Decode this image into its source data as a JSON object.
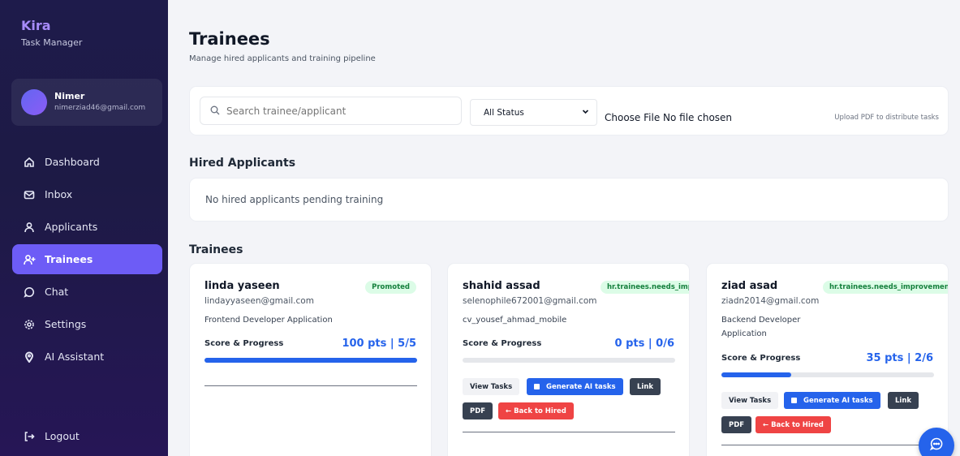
{
  "brand": {
    "name": "Kira",
    "subtitle": "Task Manager"
  },
  "user": {
    "name": "Nimer",
    "email": "nimerziad46@gmail.com"
  },
  "nav": {
    "items": [
      {
        "label": "Dashboard",
        "icon": "home-icon"
      },
      {
        "label": "Inbox",
        "icon": "mail-icon"
      },
      {
        "label": "Applicants",
        "icon": "user-icon"
      },
      {
        "label": "Trainees",
        "icon": "user-plus-icon",
        "active": true
      },
      {
        "label": "Chat",
        "icon": "chat-icon"
      },
      {
        "label": "Settings",
        "icon": "gear-icon"
      },
      {
        "label": "AI Assistant",
        "icon": "pin-icon"
      }
    ],
    "logout": "Logout"
  },
  "header": {
    "title": "Trainees",
    "subtitle": "Manage hired applicants and training pipeline"
  },
  "filters": {
    "search_placeholder": "Search trainee/applicant",
    "status_value": "All Status",
    "file_label": "Choose File No file chosen",
    "upload_hint": "Upload PDF to distribute tasks"
  },
  "hired": {
    "title": "Hired Applicants",
    "empty_text": "No hired applicants pending training"
  },
  "trainees": {
    "title": "Trainees",
    "score_label": "Score & Progress",
    "buttons": {
      "view": "View Tasks",
      "generate": "Generate AI tasks",
      "link": "Link",
      "pdf": "PDF",
      "back": "← Back to Hired"
    },
    "cards": [
      {
        "name": "linda yaseen",
        "badge": "Promoted",
        "email": "lindayyaseen@gmail.com",
        "application": "Frontend Developer Application",
        "score": "100 pts | 5/5",
        "progress": 1.0
      },
      {
        "name": "shahid assad",
        "badge": "hr.trainees.needs_improvement",
        "email": "selenophile672001@gmail.com",
        "application": "cv_yousef_ahmad_mobile",
        "score": "0 pts | 0/6",
        "progress": 0.0
      },
      {
        "name": "ziad asad",
        "badge": "hr.trainees.needs_improvement",
        "email": "ziadn2014@gmail.com",
        "application": "Backend Developer Application",
        "score": "35 pts | 2/6",
        "progress": 0.33
      }
    ]
  },
  "colors": {
    "accent": "#6d5cf6",
    "primary": "#2563eb",
    "danger": "#ef4444",
    "sidebar": "#1e1b4b"
  }
}
